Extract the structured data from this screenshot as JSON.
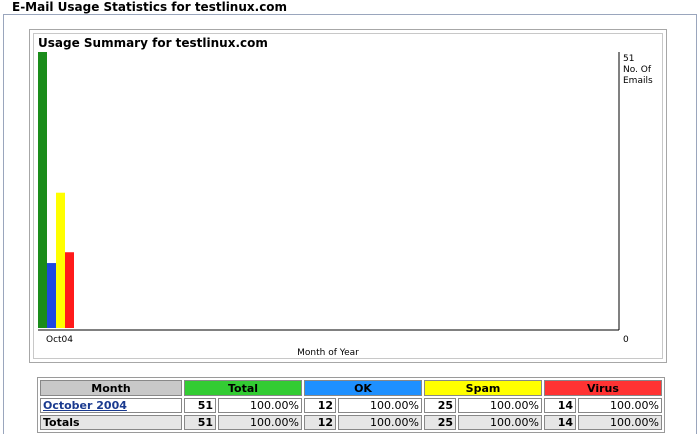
{
  "page": {
    "title": "E-Mail Usage Statistics for testlinux.com"
  },
  "chart_data": {
    "type": "bar",
    "title": "Usage Summary for testlinux.com",
    "xlabel": "Month of Year",
    "ylabel": "No. Of Emails",
    "ylabel_lines": [
      "No. Of",
      "Emails"
    ],
    "categories": [
      "Oct04"
    ],
    "series": [
      {
        "name": "Total",
        "color": "#1a8c1a",
        "values": [
          51
        ]
      },
      {
        "name": "OK",
        "color": "#1f47e0",
        "values": [
          12
        ]
      },
      {
        "name": "Spam",
        "color": "#ffff00",
        "values": [
          25
        ]
      },
      {
        "name": "Virus",
        "color": "#ff1a1a",
        "values": [
          14
        ]
      }
    ],
    "ylim": [
      0,
      51
    ],
    "y_max_label": "51",
    "y_min_label": "0"
  },
  "table": {
    "headers": [
      {
        "label": "Month",
        "bg": "#c8c8c8"
      },
      {
        "label": "Total",
        "bg": "#33cc33"
      },
      {
        "label": "OK",
        "bg": "#1e90ff"
      },
      {
        "label": "Spam",
        "bg": "#ffff00"
      },
      {
        "label": "Virus",
        "bg": "#ff3333"
      }
    ],
    "rows": [
      {
        "label": "October 2004",
        "total": "51",
        "total_pct": "100.00%",
        "ok": "12",
        "ok_pct": "100.00%",
        "spam": "25",
        "spam_pct": "100.00%",
        "virus": "14",
        "virus_pct": "100.00%"
      }
    ],
    "totals": {
      "label": "Totals",
      "total": "51",
      "total_pct": "100.00%",
      "ok": "12",
      "ok_pct": "100.00%",
      "spam": "25",
      "spam_pct": "100.00%",
      "virus": "14",
      "virus_pct": "100.00%"
    }
  }
}
